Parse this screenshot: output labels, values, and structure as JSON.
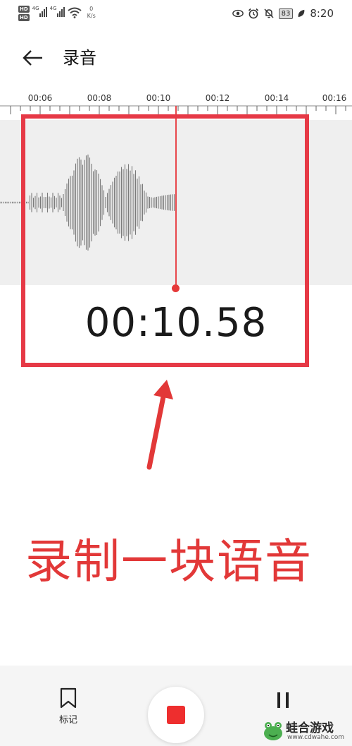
{
  "status_bar": {
    "hd_badges": [
      "HD",
      "HD"
    ],
    "network_labels": [
      "4G",
      "4G"
    ],
    "speed_value": "0",
    "speed_unit": "K/s",
    "battery": "83",
    "time": "8:20",
    "icons": [
      "eye-icon",
      "alarm-icon",
      "bell-off-icon",
      "battery-icon",
      "leaf-icon",
      "wifi-icon",
      "signal-icon"
    ]
  },
  "header": {
    "back_icon": "arrow-left-icon",
    "title": "录音"
  },
  "ruler": {
    "labels": [
      "00:06",
      "00:08",
      "00:10",
      "00:12",
      "00:14",
      "00:16"
    ]
  },
  "recorder": {
    "timer": "00:10.58"
  },
  "annotation": {
    "text": "录制一块语音",
    "color": "#e23838"
  },
  "bottom_bar": {
    "mark_label": "标记",
    "mark_icon": "bookmark-icon",
    "stop_icon": "stop-icon",
    "pause_icon": "pause-icon"
  },
  "watermark": {
    "name": "蛙合游戏",
    "url": "www.cdwahe.com"
  },
  "colors": {
    "accent": "#e8474b",
    "stop": "#ee2e2e",
    "highlight": "#e63946"
  }
}
